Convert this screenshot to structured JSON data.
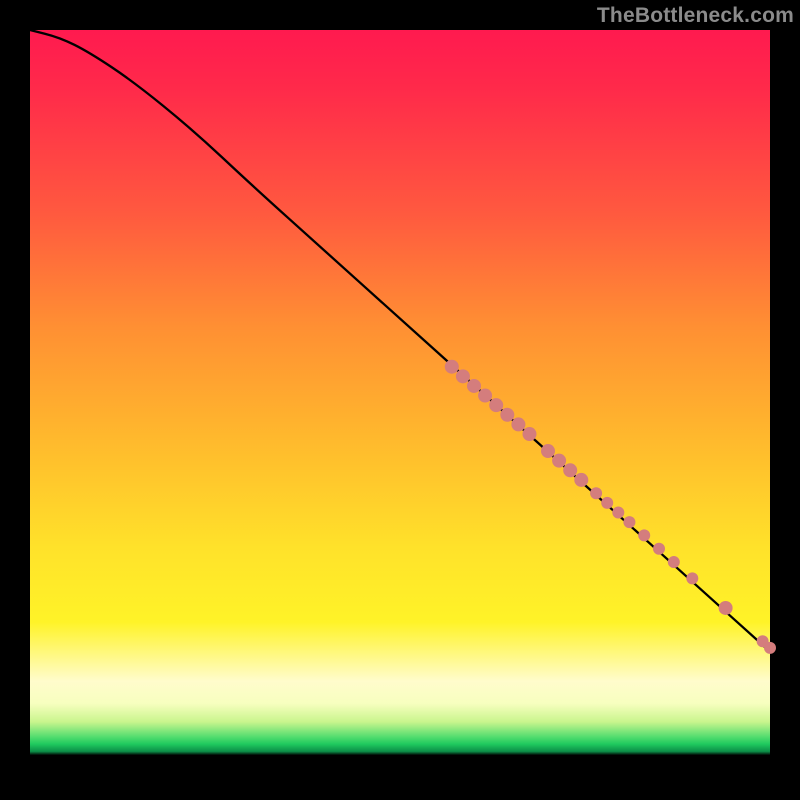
{
  "watermark": "TheBottleneck.com",
  "colors": {
    "curve_stroke": "#000000",
    "marker_fill": "#d47d7d",
    "marker_stroke": "#b05555"
  },
  "chart_data": {
    "type": "line",
    "title": "",
    "xlabel": "",
    "ylabel": "",
    "xlim": [
      0,
      100
    ],
    "ylim": [
      0,
      100
    ],
    "grid": false,
    "series": [
      {
        "name": "bottleneck-curve",
        "x": [
          0,
          4,
          8,
          14,
          22,
          30,
          40,
          50,
          60,
          70,
          80,
          90,
          100
        ],
        "y": [
          100,
          99,
          97,
          93,
          86.5,
          79,
          70,
          61,
          52,
          43,
          34,
          25,
          16
        ]
      }
    ],
    "markers": {
      "name": "highlighted-points",
      "x": [
        57,
        58.5,
        60,
        61.5,
        63,
        64.5,
        66,
        67.5,
        70,
        71.5,
        73,
        74.5,
        76.5,
        78,
        79.5,
        81,
        83,
        85,
        87,
        89.5,
        94,
        99,
        100
      ],
      "y": [
        54.5,
        53.2,
        51.9,
        50.6,
        49.3,
        48.0,
        46.7,
        45.4,
        43.1,
        41.8,
        40.5,
        39.2,
        37.4,
        36.1,
        34.8,
        33.5,
        31.7,
        29.9,
        28.1,
        25.9,
        21.9,
        17.4,
        16.5
      ],
      "r": [
        7,
        7,
        7,
        7,
        7,
        7,
        7,
        7,
        7,
        7,
        7,
        7,
        6,
        6,
        6,
        6,
        6,
        6,
        6,
        6,
        7,
        6,
        6
      ]
    }
  }
}
